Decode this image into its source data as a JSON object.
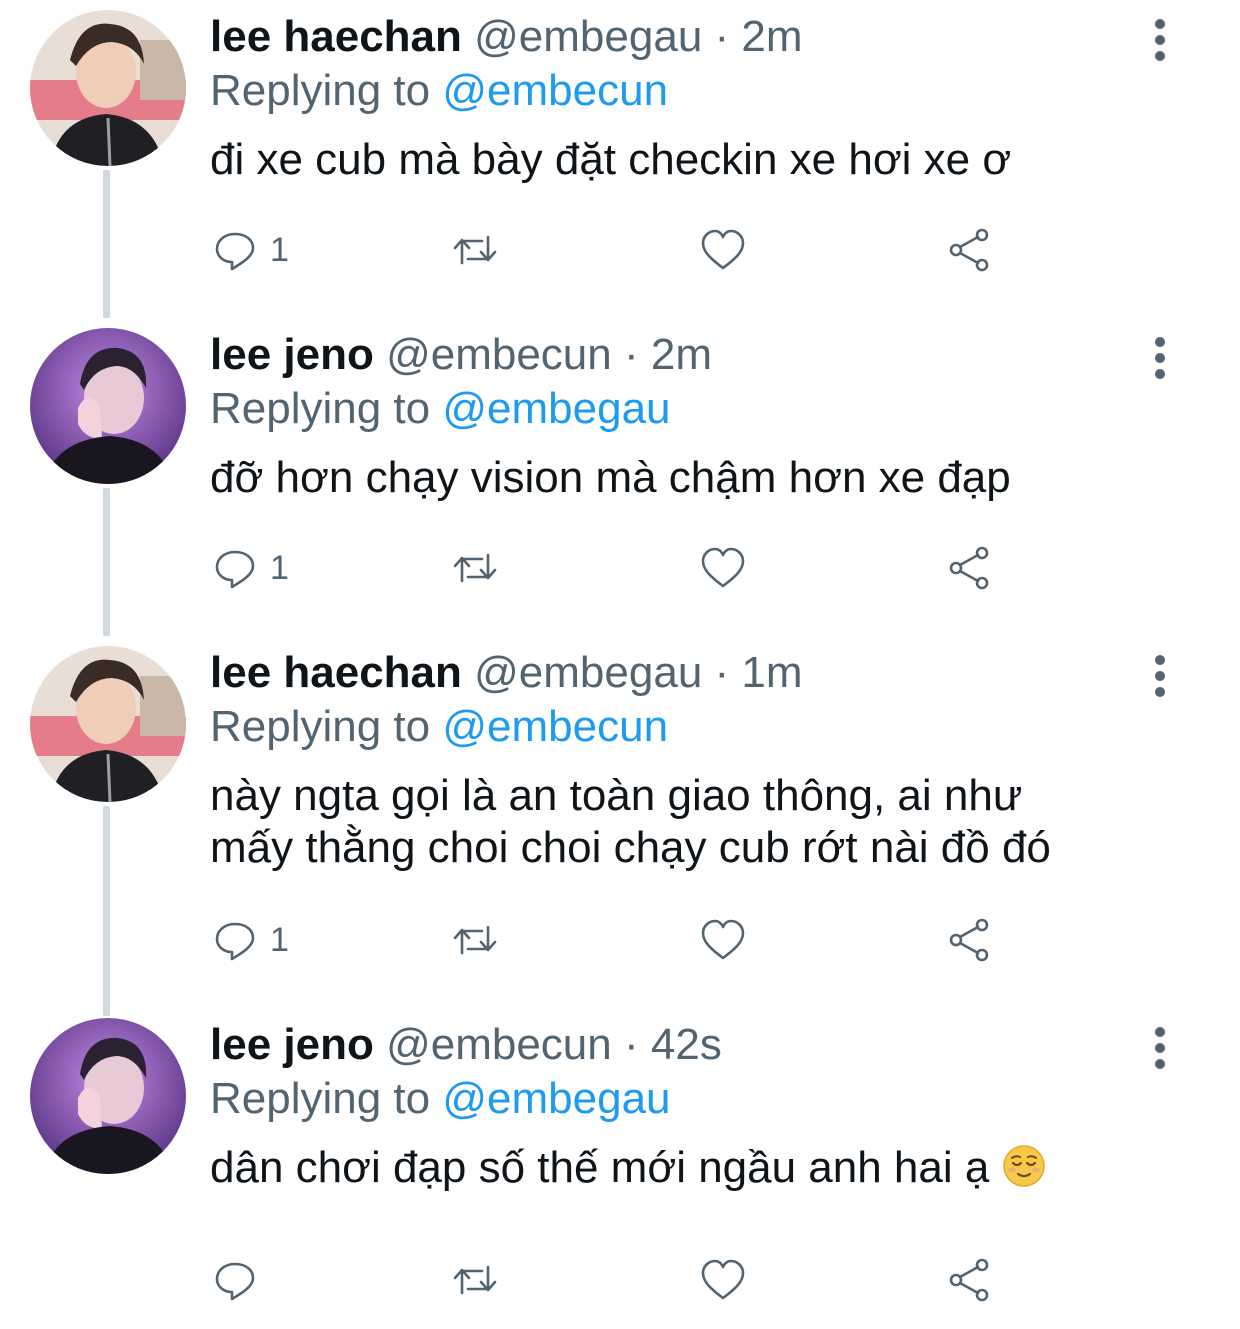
{
  "tweets": [
    {
      "name": "lee haechan",
      "handle": "@embegau",
      "separator": "·",
      "time": "2m",
      "replying_prefix": "Replying to",
      "replying_to": "@embecun",
      "text": "đi xe cub mà bày đặt checkin xe hơi xe ơ",
      "reply_count": "1",
      "avatar": "haechan"
    },
    {
      "name": "lee jeno",
      "handle": "@embecun",
      "separator": "·",
      "time": "2m",
      "replying_prefix": "Replying to",
      "replying_to": "@embegau",
      "text": "đỡ hơn chạy vision mà chậm hơn xe đạp",
      "reply_count": "1",
      "avatar": "jeno"
    },
    {
      "name": "lee haechan",
      "handle": "@embegau",
      "separator": "·",
      "time": "1m",
      "replying_prefix": "Replying to",
      "replying_to": "@embecun",
      "text_lines": [
        "này ngta gọi là an toàn giao thông, ai như",
        "mấy thằng choi choi chạy cub rớt nài đồ đó"
      ],
      "reply_count": "1",
      "avatar": "haechan"
    },
    {
      "name": "lee jeno",
      "handle": "@embecun",
      "separator": "·",
      "time": "42s",
      "replying_prefix": "Replying to",
      "replying_to": "@embegau",
      "text": "dân chơi đạp số thế mới ngầu anh hai ạ",
      "emoji": "relieved-face",
      "reply_count": "",
      "avatar": "jeno"
    }
  ],
  "icons": {
    "reply": "reply-icon",
    "retweet": "retweet-icon",
    "like": "heart-icon",
    "share": "share-icon",
    "more": "more-vertical-icon"
  },
  "colors": {
    "text": "#0f1419",
    "secondary": "#536471",
    "link": "#1d9bf0",
    "thread_line": "#cfd9de"
  }
}
